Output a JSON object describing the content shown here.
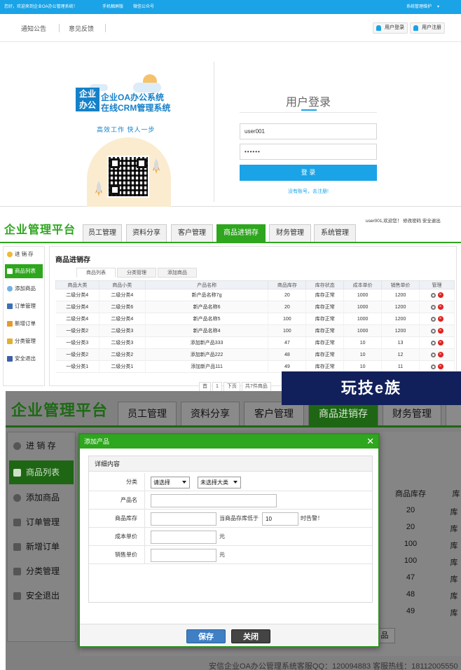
{
  "top_bar": {
    "welcome": "您好，欢迎来到企业OA办公管理系统！",
    "mobile": "手机触屏版",
    "wechat": "微信公众号",
    "sys_maintain": "系统管理维护",
    "bg_color": "#1aa3e6"
  },
  "login_nav": {
    "notice": "通知公告",
    "feedback": "意见反馈",
    "user_login": "用户登录",
    "user_register": "用户注册"
  },
  "logo": {
    "badge_line1": "企业",
    "badge_line2": "办公",
    "title1": "企业OA办公系统",
    "title2": "在线CRM管理系统",
    "slogan": "高效工作 快人一步"
  },
  "login_form": {
    "title": "用户登录",
    "username": "user001",
    "password": "••••••",
    "submit": "登 录",
    "register_link": "没有账号，去注册!",
    "accent": "#1aa3e6"
  },
  "platform": {
    "brand": "企业管理平台",
    "greeting": "user001,欢迎您！ 修改密码 安全退出",
    "tabs": [
      "员工管理",
      "资料分享",
      "客户管理",
      "商品进销存",
      "财务管理",
      "系统管理"
    ],
    "active_tab": "商品进销存",
    "accent": "#2ea61e",
    "sidebar": {
      "header": "进 销 存",
      "items": [
        "商品列表",
        "添加商品",
        "订单管理",
        "新增订单",
        "分类管理",
        "安全退出"
      ],
      "active": "商品列表"
    },
    "page_title": "商品进销存",
    "sub_tabs": [
      "商品列表",
      "分类管理",
      "添加商品"
    ],
    "table": {
      "headers": [
        "商品大类",
        "商品小类",
        "产品名称",
        "商品库存",
        "库存状态",
        "成本单价",
        "销售单价",
        "管理"
      ],
      "rows": [
        [
          "二级分类4",
          "二级分类4",
          "新产品名称7g",
          "20",
          "库存正常",
          "1000",
          "1200"
        ],
        [
          "二级分类4",
          "二级分类6",
          "新产品名称6",
          "20",
          "库存正常",
          "1000",
          "1200"
        ],
        [
          "二级分类4",
          "二级分类4",
          "新产品名称5",
          "100",
          "库存正常",
          "1000",
          "1200"
        ],
        [
          "一级分类2",
          "二级分类3",
          "新产品名称4",
          "100",
          "库存正常",
          "1000",
          "1200"
        ],
        [
          "一级分类3",
          "二级分类3",
          "添加新产品333",
          "47",
          "库存正常",
          "10",
          "13"
        ],
        [
          "一级分类2",
          "二级分类2",
          "添加新产品222",
          "48",
          "库存正常",
          "10",
          "12"
        ],
        [
          "一级分类1",
          "二级分类1",
          "添加新产品111",
          "49",
          "库存正常",
          "10",
          "11"
        ]
      ]
    },
    "pager": {
      "first": "首",
      "page": "1",
      "next": "下页",
      "total": "共7件商品"
    }
  },
  "watermark": "玩技e族",
  "zoomed": {
    "brand": "企业管理平台",
    "tabs": [
      "员工管理",
      "资料分享",
      "客户管理",
      "商品进销存",
      "财务管理"
    ],
    "active_tab": "商品进销存",
    "sidebar": [
      "进 销 存",
      "商品列表",
      "添加商品",
      "订单管理",
      "新增订单",
      "分类管理",
      "安全退出"
    ],
    "stock_header": "商品库存",
    "stock_values": [
      "20",
      "20",
      "100",
      "100",
      "47",
      "48",
      "49"
    ],
    "footer": "安信企业OA办公管理系统客服QQ：120094883 客服热线：18112005550",
    "behind_btn": "品"
  },
  "modal": {
    "title": "添加产品",
    "close": "✕",
    "legend": "详细内容",
    "category_label": "分类",
    "category_select1": "请选择",
    "category_select2": "未选择大类",
    "name_label": "产品名",
    "stock_label": "商品库存",
    "alert_text": "当商品存库低于",
    "alert_value": "10",
    "alert_suffix": "时告警！",
    "cost_label": "成本单价",
    "price_label": "销售单价",
    "unit": "元",
    "save": "保存",
    "close_btn": "关闭"
  }
}
